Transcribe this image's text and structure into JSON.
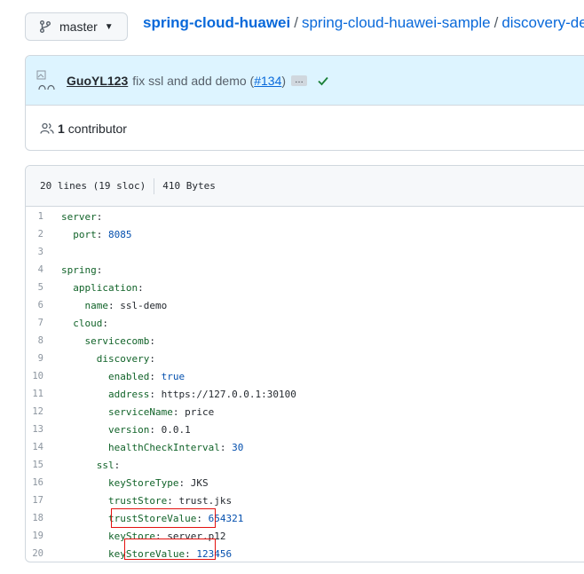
{
  "branch": {
    "label": "master"
  },
  "breadcrumb": {
    "repo": "spring-cloud-huawei",
    "sep1": "/",
    "folder": "spring-cloud-huawei-sample",
    "sep2": "/",
    "subfolder": "discovery-demo"
  },
  "commit": {
    "author": "GuoYL123",
    "message": "fix ssl and add demo (",
    "pr": "#134",
    "message_end": ")",
    "ellipsis": "…",
    "status": "success"
  },
  "contributors": {
    "count": "1",
    "label": "contributor"
  },
  "file": {
    "lines_info": "20 lines (19 sloc)",
    "size": "410 Bytes"
  },
  "code_lines": [
    {
      "n": "1",
      "indent": "",
      "key": "server",
      "value": "",
      "vtype": ""
    },
    {
      "n": "2",
      "indent": "  ",
      "key": "port",
      "value": "8085",
      "vtype": "num"
    },
    {
      "n": "3",
      "indent": "",
      "key": "",
      "value": "",
      "vtype": ""
    },
    {
      "n": "4",
      "indent": "",
      "key": "spring",
      "value": "",
      "vtype": ""
    },
    {
      "n": "5",
      "indent": "  ",
      "key": "application",
      "value": "",
      "vtype": ""
    },
    {
      "n": "6",
      "indent": "    ",
      "key": "name",
      "value": "ssl-demo",
      "vtype": "str"
    },
    {
      "n": "7",
      "indent": "  ",
      "key": "cloud",
      "value": "",
      "vtype": ""
    },
    {
      "n": "8",
      "indent": "    ",
      "key": "servicecomb",
      "value": "",
      "vtype": ""
    },
    {
      "n": "9",
      "indent": "      ",
      "key": "discovery",
      "value": "",
      "vtype": ""
    },
    {
      "n": "10",
      "indent": "        ",
      "key": "enabled",
      "value": "true",
      "vtype": "num"
    },
    {
      "n": "11",
      "indent": "        ",
      "key": "address",
      "value": "https://127.0.0.1:30100",
      "vtype": "str"
    },
    {
      "n": "12",
      "indent": "        ",
      "key": "serviceName",
      "value": "price",
      "vtype": "str"
    },
    {
      "n": "13",
      "indent": "        ",
      "key": "version",
      "value": "0.0.1",
      "vtype": "str"
    },
    {
      "n": "14",
      "indent": "        ",
      "key": "healthCheckInterval",
      "value": "30",
      "vtype": "num"
    },
    {
      "n": "15",
      "indent": "      ",
      "key": "ssl",
      "value": "",
      "vtype": ""
    },
    {
      "n": "16",
      "indent": "        ",
      "key": "keyStoreType",
      "value": "JKS",
      "vtype": "str"
    },
    {
      "n": "17",
      "indent": "        ",
      "key": "trustStore",
      "value": "trust.jks",
      "vtype": "str"
    },
    {
      "n": "18",
      "indent": "        ",
      "key": "trustStoreValue",
      "value": "654321",
      "vtype": "num"
    },
    {
      "n": "19",
      "indent": "        ",
      "key": "keyStore",
      "value": "server.p12",
      "vtype": "str"
    },
    {
      "n": "20",
      "indent": "        ",
      "key": "keyStoreValue",
      "value": "123456",
      "vtype": "num"
    }
  ],
  "colors": {
    "link": "#0969da",
    "key": "#116329",
    "number": "#0550ae",
    "highlight_box": "#e3110f",
    "commit_bg": "#ddf4ff"
  }
}
